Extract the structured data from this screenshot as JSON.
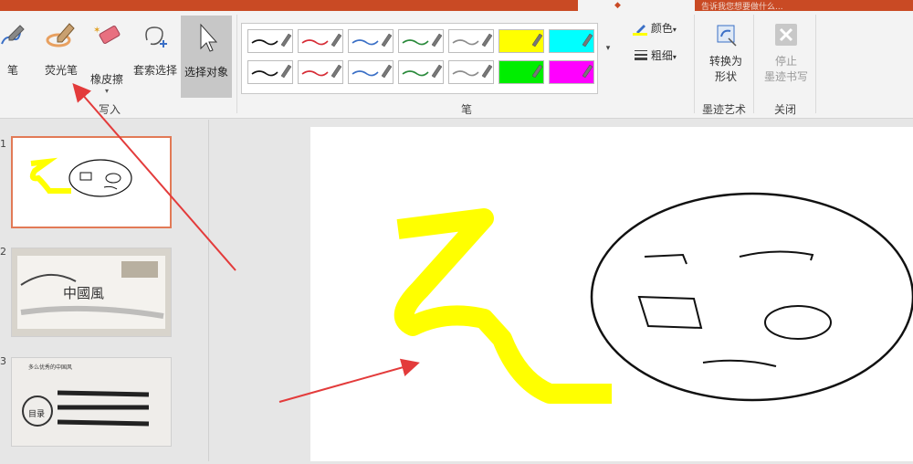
{
  "title_bar": {
    "right_text": "告诉我您想要做什么..."
  },
  "ribbon": {
    "write_group": {
      "label": "写入",
      "pen_label": "笔",
      "highlighter_label": "荧光笔",
      "eraser_label": "橡皮擦",
      "eraser_dropdown": "▾",
      "lasso_label": "套索选择",
      "select_objects_label": "选择对象"
    },
    "pens_group": {
      "label": "笔",
      "pens": [
        {
          "color": "#111111",
          "type": "pen"
        },
        {
          "color": "#d62b35",
          "type": "pen"
        },
        {
          "color": "#3a6fc6",
          "type": "pen"
        },
        {
          "color": "#2a8a3b",
          "type": "pen"
        },
        {
          "color": "#8c8c8c",
          "type": "pen"
        },
        {
          "color": "#ffff00",
          "type": "highlighter"
        },
        {
          "color": "#00ffff",
          "type": "highlighter"
        },
        {
          "color": "#111111",
          "type": "pen"
        },
        {
          "color": "#d62b35",
          "type": "pen"
        },
        {
          "color": "#3a6fc6",
          "type": "pen"
        },
        {
          "color": "#2a8a3b",
          "type": "pen"
        },
        {
          "color": "#8c8c8c",
          "type": "pen"
        },
        {
          "color": "#00ee00",
          "type": "highlighter"
        },
        {
          "color": "#ff00ff",
          "type": "highlighter"
        }
      ],
      "color_label": "颜色",
      "thickness_label": "粗细"
    },
    "ink_art_group": {
      "label": "墨迹艺术",
      "convert_label_1": "转换为",
      "convert_label_2": "形状"
    },
    "close_group": {
      "label": "关闭",
      "stop_label_1": "停止",
      "stop_label_2": "墨迹书写"
    }
  },
  "slides": [
    {
      "number": "1",
      "selected": true
    },
    {
      "number": "2",
      "title_text": "中國風",
      "selected": false
    },
    {
      "number": "3",
      "header_text": "多么优秀的中国风",
      "toc_text": "目录",
      "selected": false
    }
  ],
  "colors": {
    "accent": "#c94a24",
    "highlight_ink": "#ffff00",
    "arrow": "#e33b3b"
  }
}
